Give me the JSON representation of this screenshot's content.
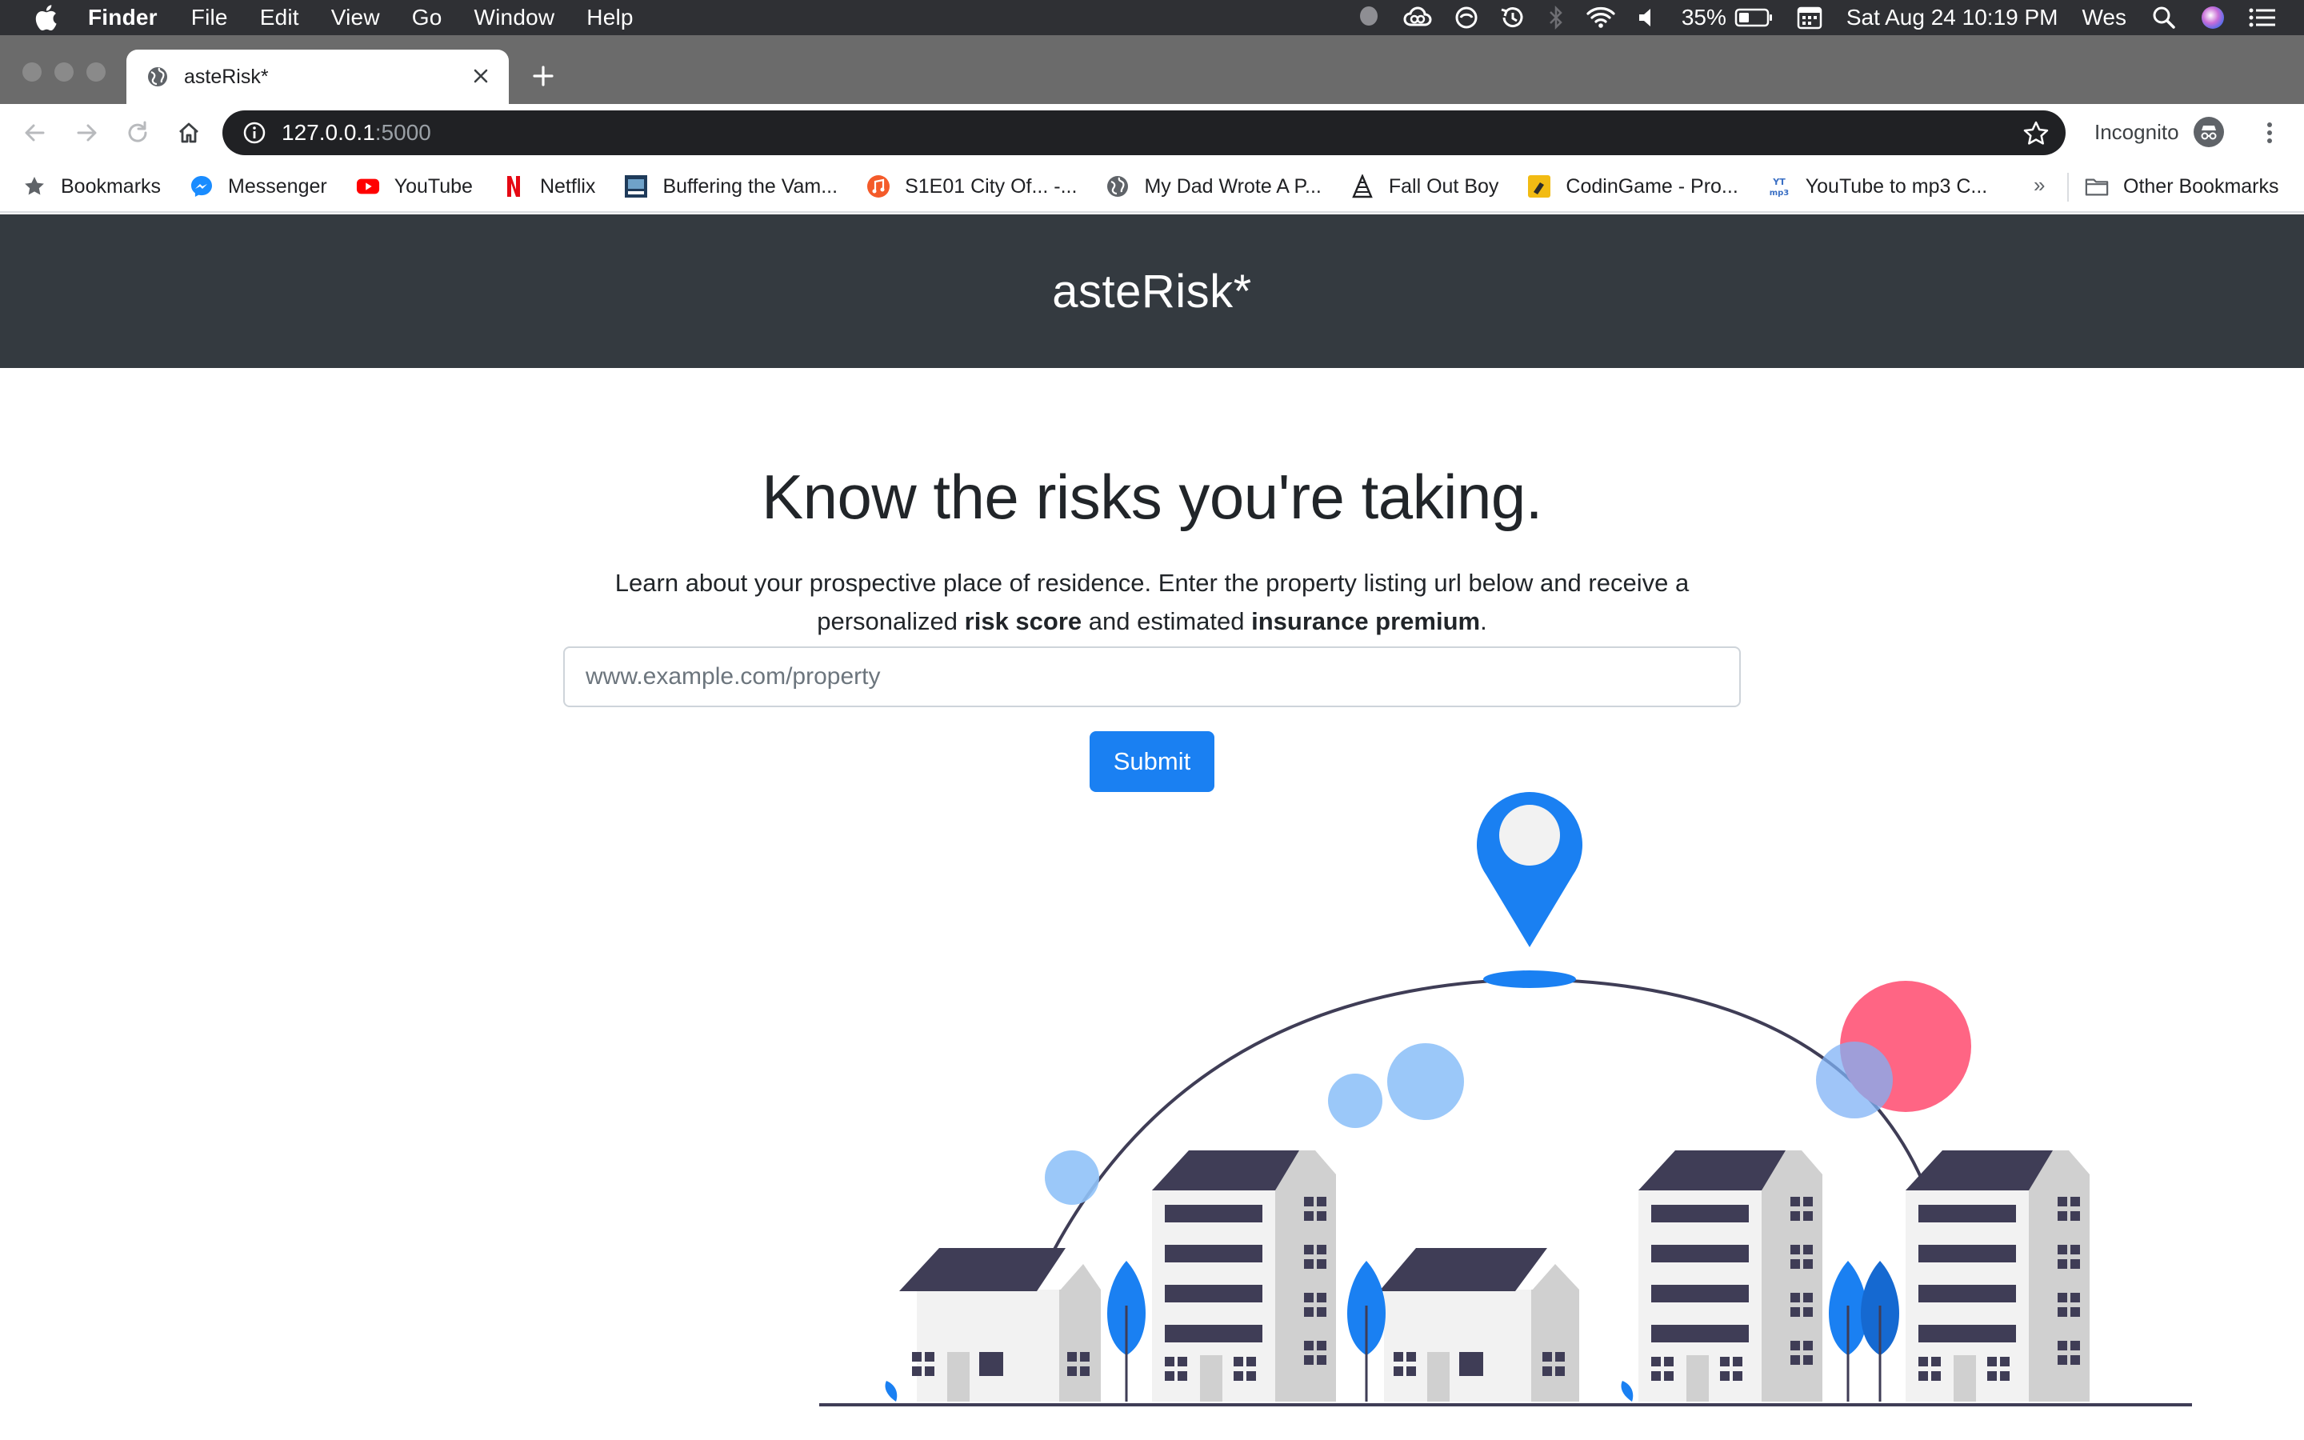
{
  "menubar": {
    "app": "Finder",
    "items": [
      "File",
      "Edit",
      "View",
      "Go",
      "Window",
      "Help"
    ],
    "battery": "35%",
    "datetime": "Sat Aug 24  10:19 PM",
    "user": "Wes"
  },
  "browser": {
    "tab_title": "asteRisk*",
    "url_host": "127.0.0.1",
    "url_port": ":5000",
    "incognito_label": "Incognito",
    "bookmarks": [
      {
        "label": "Bookmarks",
        "icon": "star-icon"
      },
      {
        "label": "Messenger",
        "icon": "messenger-icon"
      },
      {
        "label": "YouTube",
        "icon": "youtube-icon"
      },
      {
        "label": "Netflix",
        "icon": "netflix-icon"
      },
      {
        "label": "Buffering the Vam...",
        "icon": "buffering-icon"
      },
      {
        "label": "S1E01 City Of... -...",
        "icon": "podcast-icon"
      },
      {
        "label": "My Dad Wrote A P...",
        "icon": "globe-icon"
      },
      {
        "label": "Fall Out Boy",
        "icon": "fob-icon"
      },
      {
        "label": "CodinGame - Pro...",
        "icon": "codingame-icon"
      },
      {
        "label": "YouTube to mp3 C...",
        "icon": "ytmp3-icon"
      }
    ],
    "overflow": "»",
    "other_bookmarks": "Other Bookmarks"
  },
  "page": {
    "brand": "asteRisk*",
    "headline": "Know the risks you're taking.",
    "lead_1": "Learn about your prospective place of residence. Enter the property listing url below and receive a personalized ",
    "lead_bold_1": "risk score",
    "lead_2": " and estimated ",
    "lead_bold_2": "insurance premium",
    "lead_3": ".",
    "input_placeholder": "www.example.com/property",
    "submit_label": "Submit"
  },
  "colors": {
    "header_bg": "#343a40",
    "primary": "#1a80f2",
    "light_blue": "#90c2f8",
    "pink": "#ff6584",
    "roof": "#3f3d56",
    "building_gray": "#d0d0d0"
  }
}
